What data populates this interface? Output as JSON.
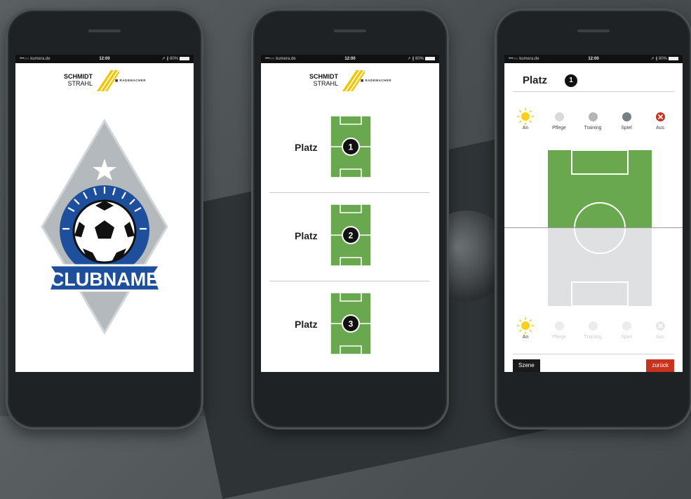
{
  "status": {
    "carrier": "•••○○ kumera.de",
    "time": "12:00",
    "battery": "➚ ∦ 80%"
  },
  "brand": {
    "line1": "SCHMIDT",
    "line2": "STRAHL",
    "partner": "▦ RADEMACHER"
  },
  "club": {
    "name": "CLUBNAME"
  },
  "court_list": {
    "label": "Platz",
    "courts": [
      "1",
      "2",
      "3"
    ]
  },
  "detail": {
    "title": "Platz",
    "number": "1",
    "modes": [
      "An",
      "Pflege",
      "Training",
      "Spiel",
      "Aus"
    ],
    "buttons": {
      "scene": "Szene",
      "back": "zurück"
    }
  },
  "colors": {
    "grass": "#6aa84f",
    "inactive_half": "#dfe0e1",
    "sun": "#f7d117",
    "off_red": "#c8321e",
    "club_blue": "#1d4f9c",
    "diamond_grey": "#b4b9bd"
  }
}
